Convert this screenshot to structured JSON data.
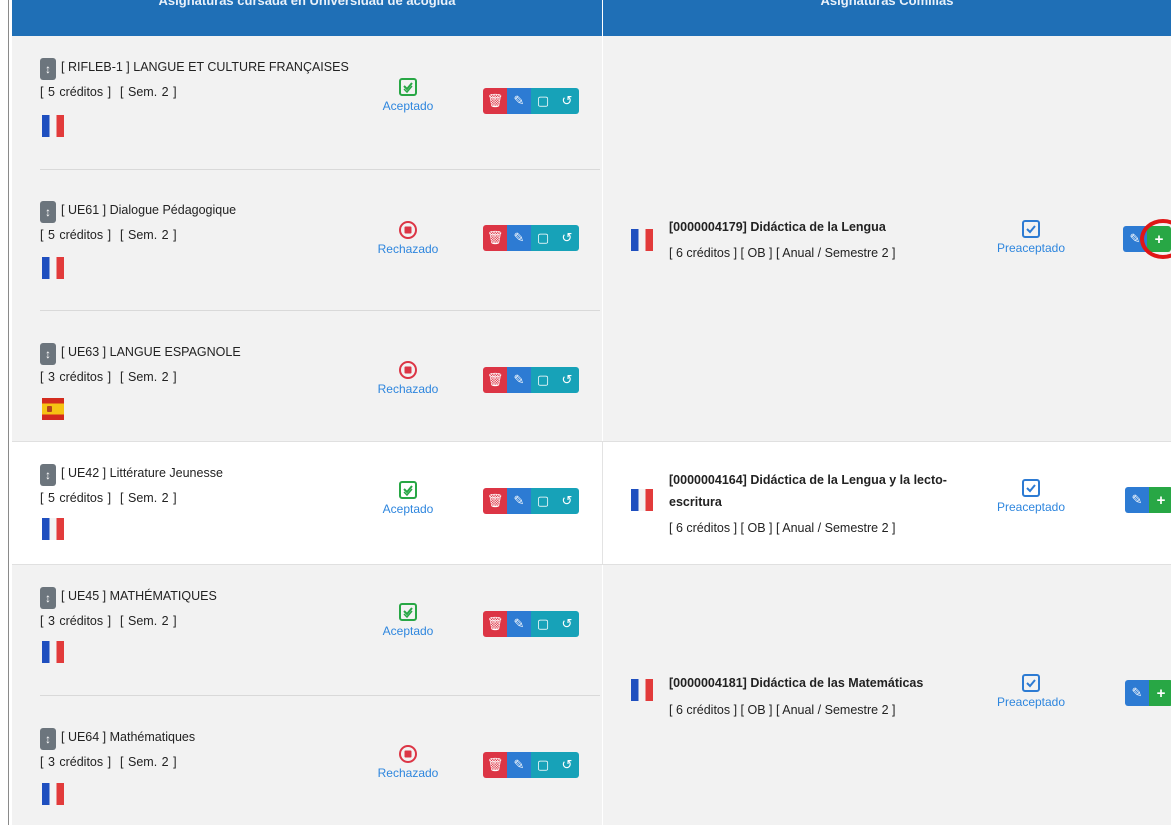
{
  "header": {
    "left_title": "Asignaturas cursada en Universidad de acogida",
    "right_title": "Asignaturas Comillas"
  },
  "icons": {
    "move": "up-down-arrow-icon",
    "delete": "trash-icon",
    "edit": "pencil-icon",
    "comment": "comment-icon",
    "history": "history-icon",
    "add": "plus-icon",
    "accepted": "check-square-icon",
    "rejected": "x-circle-icon",
    "preaccepted": "check-box-icon"
  },
  "colors": {
    "header_bg": "#1f6fb6",
    "accepted_green": "#28a745",
    "rejected_red": "#dc3545",
    "status_text": "#2e86de",
    "highlight": "#e01616"
  },
  "host_subjects": [
    {
      "code": "[ RIFLEB-1 ] LANGUE ET CULTURE FRANÇAISES",
      "credits": "[ 5 créditos ]",
      "semester": "[ Sem. 2 ]",
      "flag": "fr",
      "status": "Aceptado"
    },
    {
      "code": "[ UE61 ] Dialogue Pédagogique",
      "credits": "[ 5 créditos ]",
      "semester": "[ Sem. 2 ]",
      "flag": "fr",
      "status": "Rechazado"
    },
    {
      "code": "[ UE63 ] LANGUE ESPAGNOLE",
      "credits": "[ 3 créditos ]",
      "semester": "[ Sem. 2 ]",
      "flag": "es",
      "status": "Rechazado"
    },
    {
      "code": "[ UE42 ] Littérature Jeunesse",
      "credits": "[ 5 créditos ]",
      "semester": "[ Sem. 2 ]",
      "flag": "fr",
      "status": "Aceptado"
    },
    {
      "code": "[ UE45 ] MATHÉMATIQUES",
      "credits": "[ 3 créditos ]",
      "semester": "[ Sem. 2 ]",
      "flag": "fr",
      "status": "Aceptado"
    },
    {
      "code": "[ UE64 ] Mathématiques",
      "credits": "[ 3 créditos ]",
      "semester": "[ Sem. 2 ]",
      "flag": "fr",
      "status": "Rechazado"
    }
  ],
  "comillas_subjects": [
    {
      "title": "[0000004179] Didáctica de la Lengua",
      "meta": "[ 6 créditos ] [ OB ]  [ Anual / Semestre 2 ]",
      "status": "Preaceptado"
    },
    {
      "title": "[0000004164] Didáctica de la Lengua y la lecto-escritura",
      "meta": "[ 6 créditos ] [ OB ]  [ Anual / Semestre 2 ]",
      "status": "Preaceptado"
    },
    {
      "title": "[0000004181] Didáctica de las Matemáticas",
      "meta": "[ 6 créditos ] [ OB ]  [ Anual / Semestre 2 ]",
      "status": "Preaceptado"
    }
  ]
}
